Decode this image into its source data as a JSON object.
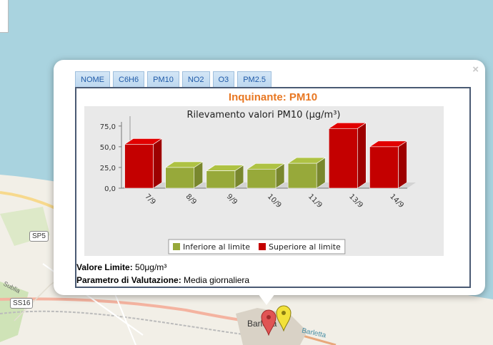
{
  "map": {
    "road_labels": [
      "SP5",
      "SS16"
    ],
    "town_label": "Barletta",
    "small_label": "Sublia",
    "sea_label": "Barletta"
  },
  "popup": {
    "close_label": "×",
    "tabs": [
      {
        "label": "NOME"
      },
      {
        "label": "C6H6"
      },
      {
        "label": "PM10"
      },
      {
        "label": "NO2"
      },
      {
        "label": "O3"
      },
      {
        "label": "PM2.5"
      }
    ],
    "title": "Inquinante: PM10",
    "limit_label": "Valore Limite:",
    "limit_value": " 50μg/m³",
    "param_label": "Parametro di Valutazione:",
    "param_value": " Media giornaliera"
  },
  "colors": {
    "below": "#97a93a",
    "above": "#c40000",
    "title": "#e87722",
    "tab_text": "#1f5aa8"
  },
  "chart_data": {
    "type": "bar",
    "title": "Rilevamento valori PM10 (μg/m³)",
    "categories": [
      "7/9",
      "8/9",
      "9/9",
      "10/9",
      "11/9",
      "13/9",
      "14/9"
    ],
    "values": [
      53,
      25,
      21,
      23,
      30,
      72,
      50
    ],
    "status": [
      "above",
      "below",
      "below",
      "below",
      "below",
      "above",
      "above"
    ],
    "ylim": [
      0,
      80
    ],
    "yticks": [
      "0,0",
      "25,0",
      "50,0",
      "75,0"
    ],
    "ytick_values": [
      0,
      25,
      50,
      75
    ],
    "legend": [
      {
        "key": "below",
        "label": "Inferiore al limite"
      },
      {
        "key": "above",
        "label": "Superiore al limite"
      }
    ],
    "legend_position": "bottom",
    "grid": false
  }
}
